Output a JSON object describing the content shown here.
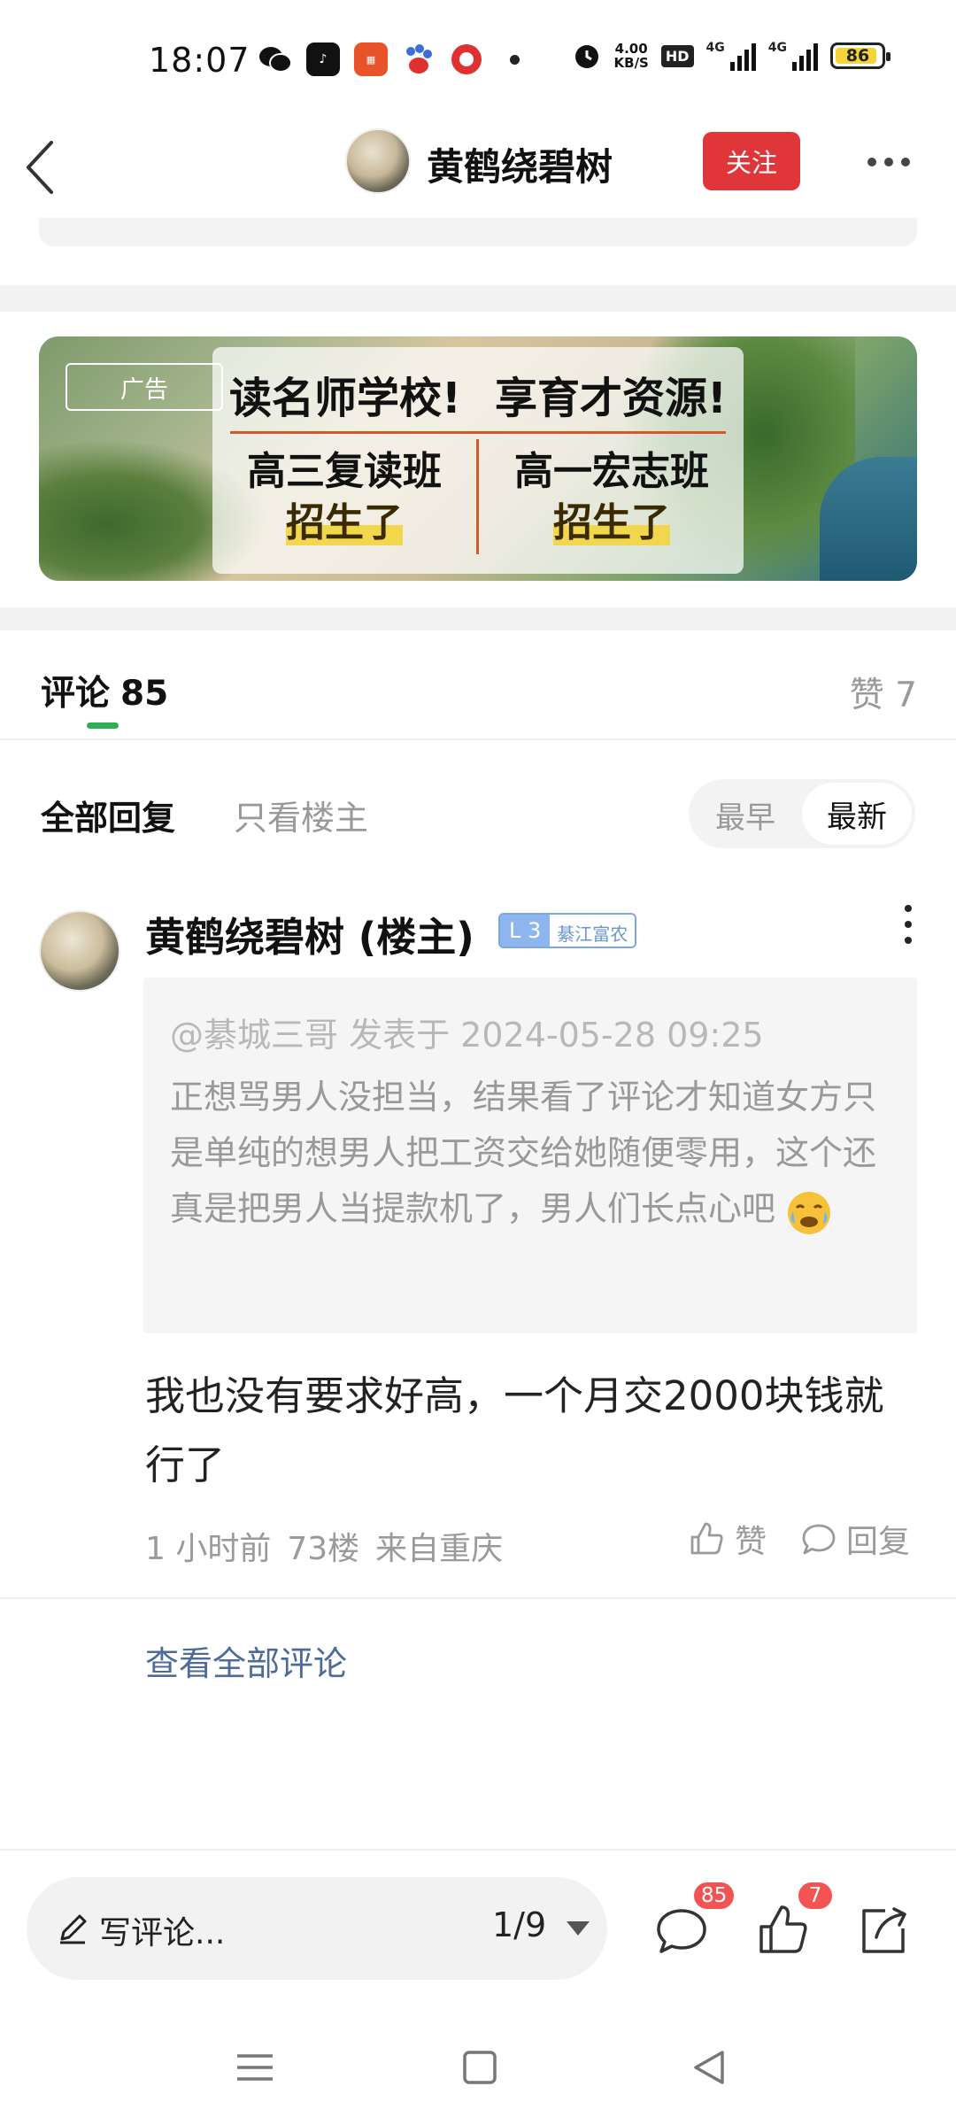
{
  "status_bar": {
    "time": "18:07",
    "speed_value": "4.00",
    "speed_unit": "KB/S",
    "hd": "HD",
    "net1": "4G",
    "net2": "4G",
    "battery": "86",
    "icons": [
      "wechat-icon",
      "tiktok-icon",
      "ping-an-bank-icon",
      "baidu-icon",
      "video-app-icon",
      "notification-dot-icon",
      "alarm-icon"
    ]
  },
  "header": {
    "author_name": "黄鹤绕碧树",
    "follow_label": "关注"
  },
  "ad": {
    "tag": "广告",
    "headline_left": "读名师学校!",
    "headline_right": "享育才资源!",
    "left_line1": "高三复读班",
    "left_line2": "招生了",
    "right_line1": "高一宏志班",
    "right_line2": "招生了"
  },
  "comments_bar": {
    "label": "评论",
    "count": "85",
    "likes_label": "赞 7"
  },
  "filters": {
    "all": "全部回复",
    "op_only": "只看楼主",
    "earliest": "最早",
    "latest": "最新"
  },
  "comment": {
    "author": "黄鹤绕碧树 (楼主)",
    "level": "L 3",
    "level_tag": "綦江富农",
    "quote_meta": "@綦城三哥 发表于 2024-05-28 09:25",
    "quote_text": "正想骂男人没担当，结果看了评论才知道女方只是单纯的想男人把工资交给她随便零用，这个还真是把男人当提款机了，男人们长点心吧",
    "reply_text": "我也没有要求好高，一个月交2000块钱就行了",
    "time": "1 小时前",
    "floor": "73楼",
    "location": "来自重庆",
    "like_label": "赞",
    "reply_label": "回复"
  },
  "view_all_label": "查看全部评论",
  "bottom_bar": {
    "write_placeholder": "写评论...",
    "page_indicator": "1/9",
    "comment_badge": "85",
    "like_badge": "7"
  },
  "colors": {
    "follow_red": "#e0363a",
    "tab_green": "#2fb056",
    "link_blue": "#4d6a99",
    "badge_red": "#f25454"
  }
}
